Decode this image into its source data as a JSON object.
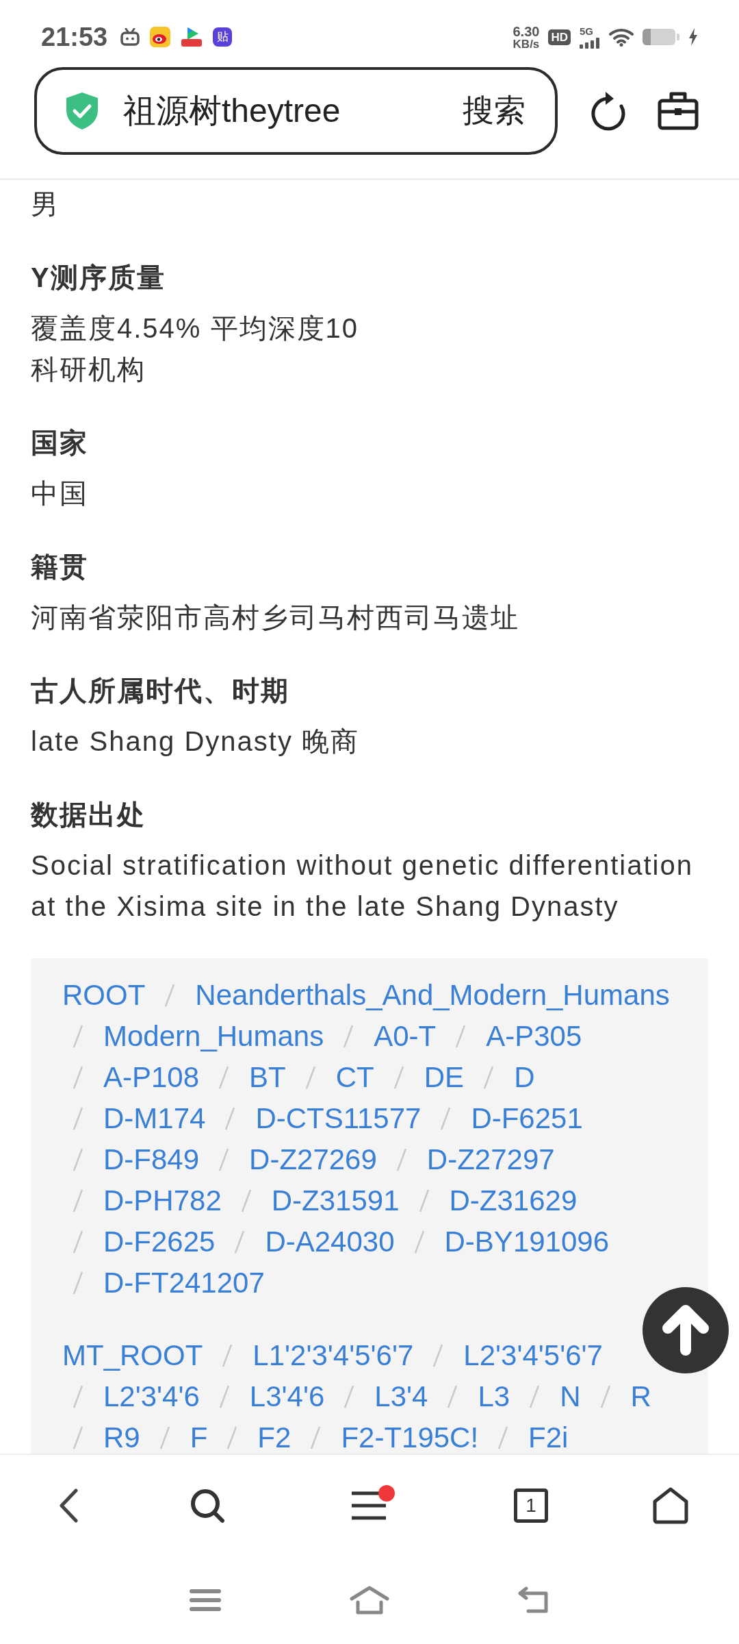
{
  "status_bar": {
    "time": "21:53",
    "app_label": "贴",
    "speed": "6.30",
    "speed_unit": "KB/s",
    "hd": "HD",
    "network": "5G"
  },
  "address_bar": {
    "title": "祖源树theytree",
    "action": "搜索"
  },
  "fields": [
    {
      "values": [
        "男"
      ]
    },
    {
      "label": "Y测序质量",
      "values": [
        "覆盖度4.54% 平均深度10",
        "科研机构"
      ]
    },
    {
      "label": "国家",
      "values": [
        "中国"
      ]
    },
    {
      "label": "籍贯",
      "values": [
        "河南省荥阳市高村乡司马村西司马遗址"
      ]
    },
    {
      "label": "古人所属时代、时期",
      "values": [
        "late Shang Dynasty 晚商"
      ]
    },
    {
      "label": "数据出处",
      "values": [
        "Social stratification without genetic differentiation at the Xisima site in the late Shang Dynasty"
      ]
    }
  ],
  "lineage": [
    {
      "nodes": [
        "ROOT",
        "Neanderthals_And_Modern_Humans",
        "Modern_Humans",
        "A0-T",
        "A-P305",
        "A-P108",
        "BT",
        "CT",
        "DE",
        "D",
        "D-M174",
        "D-CTS11577",
        "D-F6251",
        "D-F849",
        "D-Z27269",
        "D-Z27297",
        "D-PH782",
        "D-Z31591",
        "D-Z31629",
        "D-F2625",
        "D-A24030",
        "D-BY191096",
        "D-FT241207"
      ]
    },
    {
      "nodes": [
        "MT_ROOT",
        "L1'2'3'4'5'6'7",
        "L2'3'4'5'6'7",
        "L2'3'4'6",
        "L3'4'6",
        "L3'4",
        "L3",
        "N",
        "R",
        "R9",
        "F",
        "F2",
        "F2-T195C!",
        "F2i"
      ]
    }
  ],
  "bottom_nav": {
    "tab_count": "1",
    "menu_badge": true
  }
}
